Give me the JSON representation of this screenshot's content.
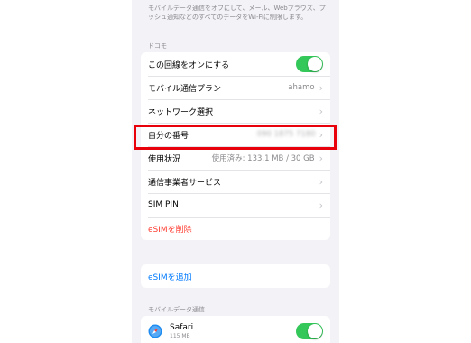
{
  "footnote": "モバイルデータ通信をオフにして、メール、Webブラウズ、プッシュ通知などのすべてのデータをWi-Fiに制限します。",
  "carrier_header": "ドコモ",
  "settings": {
    "line_on_label": "この回線をオンにする",
    "line_on": true,
    "plan_label": "モバイル通信プラン",
    "plan_value": "ahamo",
    "network_label": "ネットワーク選択",
    "my_number_label": "自分の番号",
    "my_number_value": "090 1875 7180",
    "usage_label": "使用状況",
    "usage_value": "使用済み: 133.1 MB / 30 GB",
    "carrier_services_label": "通信事業者サービス",
    "sim_pin_label": "SIM PIN",
    "delete_esim_label": "eSIMを削除"
  },
  "add_esim_label": "eSIMを追加",
  "mobile_data_header": "モバイルデータ通信",
  "apps": [
    {
      "name": "Safari",
      "size": "115 MB",
      "enabled": true,
      "icon": "safari-icon"
    }
  ],
  "colors": {
    "accent_blue": "#007aff",
    "destructive_red": "#ff3b30",
    "toggle_green": "#34c759",
    "highlight_red": "#e8000b"
  }
}
